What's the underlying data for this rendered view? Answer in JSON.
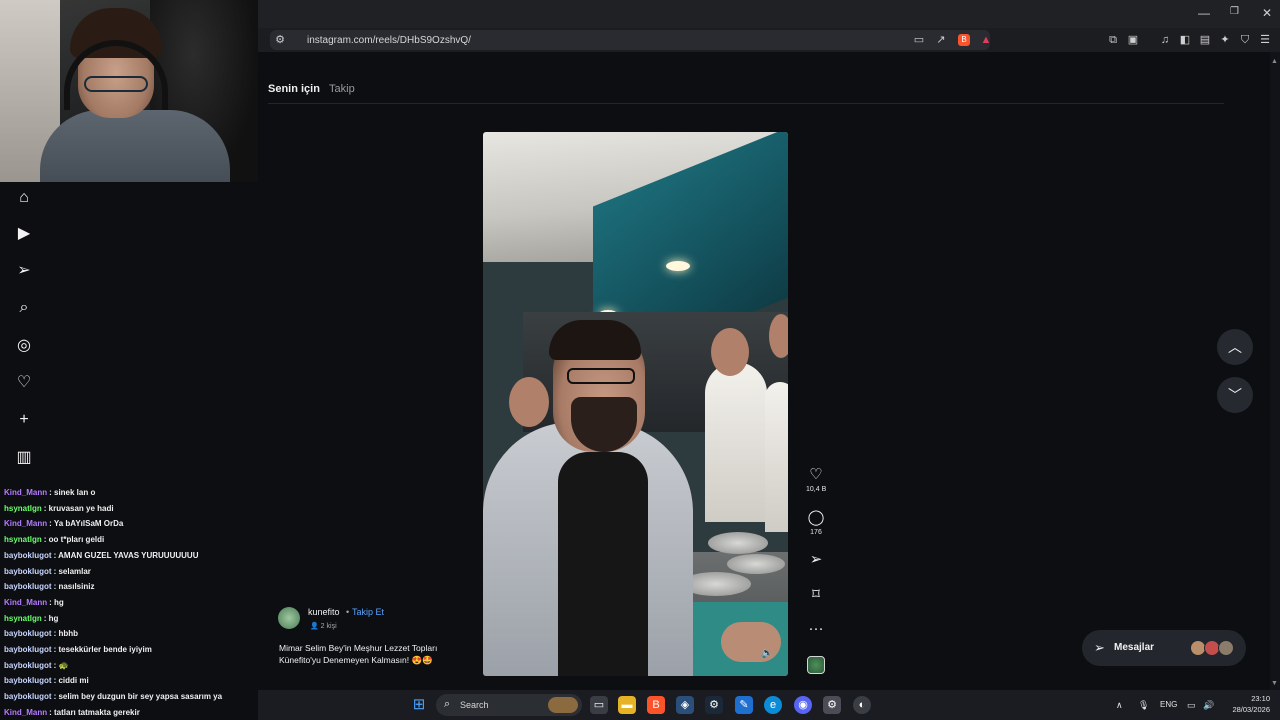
{
  "browser": {
    "url": "instagram.com/reels/DHbS9OzshvQ/",
    "window_controls": [
      "—",
      "❐",
      "✕"
    ]
  },
  "feed_tabs": {
    "for_you": "Senin için",
    "following": "Takip"
  },
  "reel": {
    "author": "kunefito",
    "separator": "•",
    "follow_label": "Takip Et",
    "audience": "2 kişi",
    "caption": "Mimar Selim Bey'in Meşhur Lezzet Topları Künefito'yu Denemeyen Kalmasın! 😍🤩",
    "likes": "10,4 B",
    "comments": "176",
    "mute_icon": "🔈",
    "more_icon": "···"
  },
  "messages": {
    "label": "Mesajlar"
  },
  "chat": [
    {
      "user": "Kind_Mann",
      "text": ": sinek lan o",
      "color": "#b67cff"
    },
    {
      "user": "hsynatlgn",
      "text": ": kruvasan ye hadi",
      "color": "#6bff6b"
    },
    {
      "user": "Kind_Mann",
      "text": ": Ya bAYılSaM OrDa",
      "color": "#b67cff"
    },
    {
      "user": "hsynatlgn",
      "text": ": oo t*pları geldi",
      "color": "#6bff6b"
    },
    {
      "user": "bayboklugot",
      "text": ": AMAN GUZEL YAVAS YURUUUUUUU",
      "color": "#c9d6ff"
    },
    {
      "user": "bayboklugot",
      "text": ": selamlar",
      "color": "#c9d6ff"
    },
    {
      "user": "bayboklugot",
      "text": ": nasılsiniz",
      "color": "#c9d6ff"
    },
    {
      "user": "Kind_Mann",
      "text": ": hg",
      "color": "#b67cff"
    },
    {
      "user": "hsynatlgn",
      "text": ": hg",
      "color": "#6bff6b"
    },
    {
      "user": "bayboklugot",
      "text": ": hbhb",
      "color": "#c9d6ff"
    },
    {
      "user": "bayboklugot",
      "text": ": tesekkürler bende iyiyim",
      "color": "#c9d6ff"
    },
    {
      "user": "bayboklugot",
      "text": ": 🐢",
      "color": "#c9d6ff"
    },
    {
      "user": "bayboklugot",
      "text": ": ciddi mi",
      "color": "#c9d6ff"
    },
    {
      "user": "bayboklugot",
      "text": ": selim bey duzgun bir sey yapsa sasarım ya",
      "color": "#c9d6ff"
    },
    {
      "user": "Kind_Mann",
      "text": ": tatları tatmakta gerekir",
      "color": "#b67cff"
    }
  ],
  "taskbar": {
    "search_label": "Search",
    "language": "ENG",
    "time": "23:10",
    "date": "28/03/2026"
  },
  "colors": {
    "accent_link": "#5aa3ff",
    "background": "#0c0e12"
  }
}
